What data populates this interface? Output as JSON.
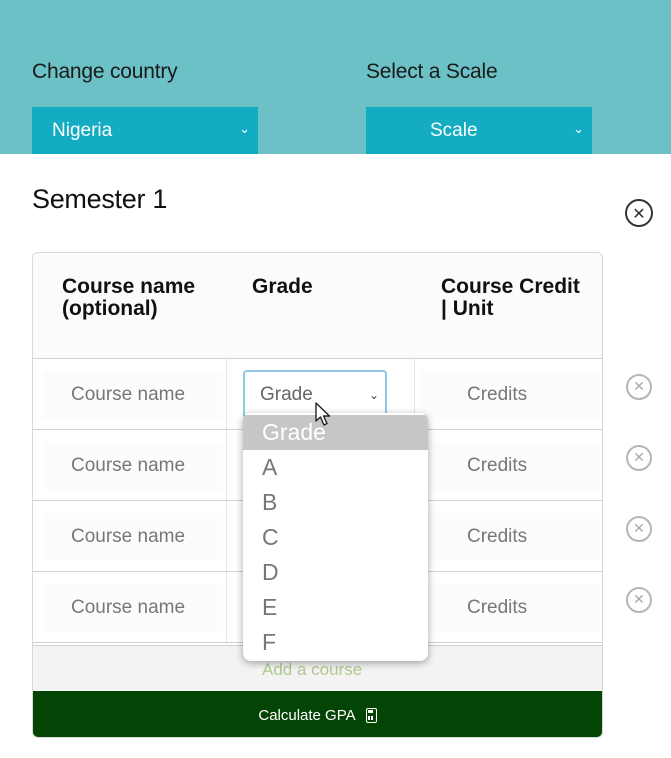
{
  "country": {
    "label": "Change country",
    "value": "Nigeria"
  },
  "scale": {
    "label": "Select a Scale",
    "value": "Scale"
  },
  "semester": {
    "title": "Semester 1"
  },
  "columns": {
    "course": "Course name\n(optional)",
    "grade": "Grade",
    "credit": "Course Credit\n| Unit"
  },
  "rows": [
    {
      "course_placeholder": "Course name",
      "grade_value": "Grade",
      "credit_placeholder": "Credits"
    },
    {
      "course_placeholder": "Course name",
      "credit_placeholder": "Credits"
    },
    {
      "course_placeholder": "Course name",
      "credit_placeholder": "Credits"
    },
    {
      "course_placeholder": "Course name",
      "credit_placeholder": "Credits"
    }
  ],
  "add_course": "Add a course",
  "calculate": "Calculate GPA",
  "grade_options": [
    "Grade",
    "A",
    "B",
    "C",
    "D",
    "E",
    "F"
  ],
  "icons": {
    "close": "circle-x-icon",
    "calculator": "calculator-icon",
    "chevron": "chevron-down-icon",
    "cursor": "mouse-pointer-icon"
  },
  "colors": {
    "header_bg": "#6cc1c6",
    "select_bg": "#14acc3",
    "calc_bg": "#044404",
    "add_link": "#b2c98f",
    "option_highlight": "#c6c6c6"
  }
}
